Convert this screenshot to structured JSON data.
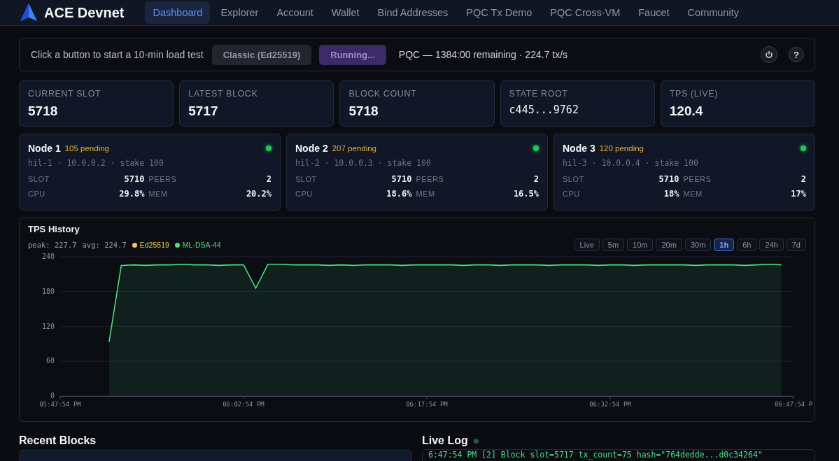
{
  "brand": {
    "name": "ACE Devnet"
  },
  "nav": [
    {
      "label": "Dashboard",
      "selected": true
    },
    {
      "label": "Explorer",
      "selected": false
    },
    {
      "label": "Account",
      "selected": false
    },
    {
      "label": "Wallet",
      "selected": false
    },
    {
      "label": "Bind Addresses",
      "selected": false
    },
    {
      "label": "PQC Tx Demo",
      "selected": false
    },
    {
      "label": "PQC Cross-VM",
      "selected": false
    },
    {
      "label": "Faucet",
      "selected": false
    },
    {
      "label": "Community",
      "selected": false
    }
  ],
  "load_test": {
    "hint": "Click a button to start a 10-min load test",
    "buttons": [
      {
        "label": "Classic (Ed25519)",
        "kind": "idle"
      },
      {
        "label": "Running...",
        "kind": "running"
      }
    ],
    "status": "PQC — 1384:00 remaining · 224.7 tx/s",
    "help": "?"
  },
  "stats": [
    {
      "label": "CURRENT SLOT",
      "value": "5718",
      "kind": "number"
    },
    {
      "label": "LATEST BLOCK",
      "value": "5717",
      "kind": "number"
    },
    {
      "label": "BLOCK COUNT",
      "value": "5718",
      "kind": "number"
    },
    {
      "label": "STATE ROOT",
      "value": "c445...9762",
      "kind": "hash"
    },
    {
      "label": "TPS (LIVE)",
      "value": "120.4",
      "kind": "number"
    }
  ],
  "nodes": [
    {
      "name": "Node 1",
      "pending": "105 pending",
      "online": true,
      "info": "hil-1 · 10.0.0.2 · stake 100",
      "metrics": [
        {
          "label": "SLOT",
          "value": "5710"
        },
        {
          "label": "PEERS",
          "value": "2"
        },
        {
          "label": "CPU",
          "value": "29.8%"
        },
        {
          "label": "MEM",
          "value": "20.2%"
        }
      ]
    },
    {
      "name": "Node 2",
      "pending": "207 pending",
      "online": true,
      "info": "hil-2 · 10.0.0.3 · stake 100",
      "metrics": [
        {
          "label": "SLOT",
          "value": "5710"
        },
        {
          "label": "PEERS",
          "value": "2"
        },
        {
          "label": "CPU",
          "value": "18.6%"
        },
        {
          "label": "MEM",
          "value": "16.5%"
        }
      ]
    },
    {
      "name": "Node 3",
      "pending": "120 pending",
      "online": true,
      "info": "hil-3 · 10.0.0.4 · stake 100",
      "metrics": [
        {
          "label": "SLOT",
          "value": "5710"
        },
        {
          "label": "PEERS",
          "value": "2"
        },
        {
          "label": "CPU",
          "value": "18%"
        },
        {
          "label": "MEM",
          "value": "17%"
        }
      ]
    }
  ],
  "tps_history": {
    "title": "TPS History",
    "peak": "peak: 227.7",
    "avg": "avg: 224.7",
    "ranges": [
      {
        "label": "Live",
        "selected": false
      },
      {
        "label": "5m",
        "selected": false
      },
      {
        "label": "10m",
        "selected": false
      },
      {
        "label": "20m",
        "selected": false
      },
      {
        "label": "30m",
        "selected": false
      },
      {
        "label": "1h",
        "selected": true
      },
      {
        "label": "6h",
        "selected": false
      },
      {
        "label": "24h",
        "selected": false
      },
      {
        "label": "7d",
        "selected": false
      }
    ],
    "chart_data": {
      "type": "area",
      "categories": [
        "05:47:54 PM",
        null,
        null,
        null,
        null,
        null,
        null,
        null,
        null,
        null,
        null,
        null,
        null,
        null,
        null,
        "06:02:54 PM",
        null,
        null,
        null,
        null,
        null,
        null,
        null,
        null,
        null,
        null,
        null,
        null,
        null,
        null,
        "06:17:54 PM",
        null,
        null,
        null,
        null,
        null,
        null,
        null,
        null,
        null,
        null,
        null,
        null,
        null,
        null,
        "06:32:54 PM",
        null,
        null,
        null,
        null,
        null,
        null,
        null,
        null,
        null,
        null,
        null,
        null,
        null,
        null,
        "06:47:54 P"
      ],
      "series": [
        {
          "name": "Ed25519",
          "color": "#f5c451",
          "values": [
            null,
            null,
            null,
            null,
            null,
            null,
            null,
            null,
            null,
            null,
            null,
            null,
            null,
            null,
            null,
            null,
            null,
            null,
            null,
            null,
            null,
            null,
            null,
            null,
            null,
            null,
            null,
            null,
            null,
            null,
            null,
            null,
            null,
            null,
            null,
            null,
            null,
            null,
            null,
            null,
            null,
            null,
            null,
            null,
            null,
            null,
            null,
            null,
            null,
            null,
            null,
            null,
            null,
            null,
            null,
            null,
            null,
            null,
            null,
            null,
            null
          ]
        },
        {
          "name": "ML-DSA-44",
          "color": "#4ade80",
          "values": [
            null,
            null,
            null,
            null,
            93,
            225,
            226,
            225,
            226,
            226,
            227,
            226,
            226,
            225,
            226,
            226,
            186,
            227,
            227,
            226,
            226,
            226,
            225,
            226,
            225,
            226,
            226,
            226,
            225,
            226,
            226,
            226,
            226,
            225,
            226,
            226,
            225,
            226,
            226,
            226,
            225,
            226,
            226,
            226,
            225,
            226,
            226,
            225,
            226,
            226,
            226,
            226,
            225,
            226,
            226,
            226,
            225,
            226,
            227,
            226,
            null
          ]
        }
      ],
      "ylim": [
        0,
        240
      ],
      "grid": true,
      "yticks": [
        0,
        60,
        120,
        180,
        240
      ]
    }
  },
  "recent_blocks": {
    "title": "Recent Blocks"
  },
  "live_log": {
    "title": "Live Log",
    "live": true,
    "lines": [
      "6:47:54 PM [2] Block slot=5717 tx_count=75 hash=\"764dedde...d0c34264\""
    ]
  }
}
